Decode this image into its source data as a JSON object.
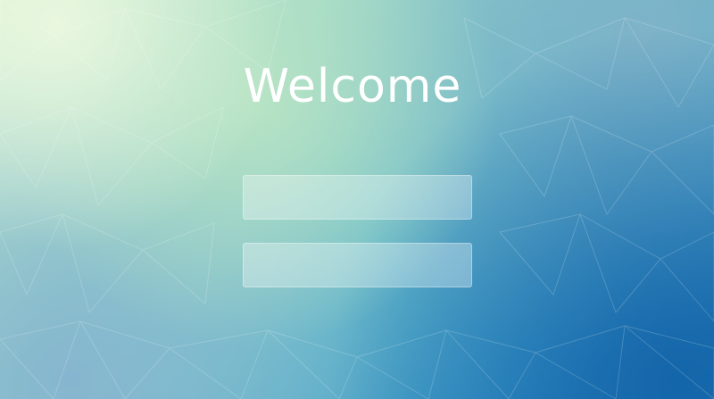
{
  "screen": {
    "title": "Welcome"
  },
  "form": {
    "username": {
      "value": "",
      "placeholder": ""
    },
    "password": {
      "value": "",
      "placeholder": ""
    }
  },
  "colors": {
    "background_top_left": "#e9f7df",
    "background_mid": "#6cbcca",
    "background_bottom_right": "#1466aa",
    "text": "#ffffff",
    "field_fill": "rgba(255,255,255,0.32)"
  }
}
